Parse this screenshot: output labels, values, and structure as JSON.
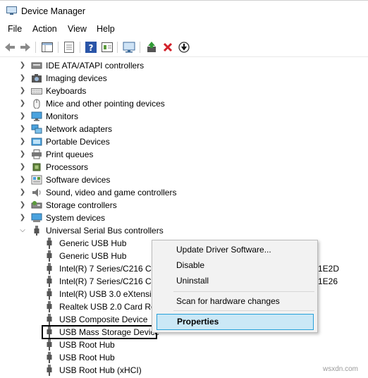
{
  "window": {
    "title": "Device Manager"
  },
  "menu": [
    "File",
    "Action",
    "View",
    "Help"
  ],
  "toolbar": {
    "icons": [
      "back-arrow-icon",
      "forward-arrow-icon",
      "show-hide-tree-icon",
      "properties-icon",
      "help-icon",
      "action-view-icon",
      "scan-monitor-icon",
      "update-driver-icon",
      "uninstall-x-icon",
      "disable-down-arrow-icon"
    ]
  },
  "tree": {
    "categories": [
      {
        "label": "IDE ATA/ATAPI controllers",
        "icon": "ide-controller-icon"
      },
      {
        "label": "Imaging devices",
        "icon": "camera-icon"
      },
      {
        "label": "Keyboards",
        "icon": "keyboard-icon"
      },
      {
        "label": "Mice and other pointing devices",
        "icon": "mouse-icon"
      },
      {
        "label": "Monitors",
        "icon": "monitor-icon"
      },
      {
        "label": "Network adapters",
        "icon": "network-adapter-icon"
      },
      {
        "label": "Portable Devices",
        "icon": "portable-device-icon"
      },
      {
        "label": "Print queues",
        "icon": "printer-icon"
      },
      {
        "label": "Processors",
        "icon": "processor-icon"
      },
      {
        "label": "Software devices",
        "icon": "software-device-icon"
      },
      {
        "label": "Sound, video and game controllers",
        "icon": "speaker-icon"
      },
      {
        "label": "Storage controllers",
        "icon": "storage-controller-icon"
      },
      {
        "label": "System devices",
        "icon": "system-device-icon"
      }
    ],
    "usb_category": {
      "label": "Universal Serial Bus controllers",
      "icon": "usb-plug-icon"
    },
    "usb_devices": [
      {
        "label": "Generic USB Hub",
        "right": ""
      },
      {
        "label": "Generic USB Hub",
        "right": ""
      },
      {
        "label": "Intel(R) 7 Series/C216 Chi",
        "right": "1E2D"
      },
      {
        "label": "Intel(R) 7 Series/C216 Chi",
        "right": "1E26"
      },
      {
        "label": "Intel(R) USB 3.0 eXtensibl",
        "right": ""
      },
      {
        "label": "Realtek USB 2.0 Card Rea",
        "right": ""
      },
      {
        "label": "USB Composite Device",
        "right": ""
      },
      {
        "label": "USB Mass Storage Device",
        "right": ""
      },
      {
        "label": "USB Root Hub",
        "right": ""
      },
      {
        "label": "USB Root Hub",
        "right": ""
      },
      {
        "label": "USB Root Hub (xHCI)",
        "right": ""
      }
    ]
  },
  "context_menu": {
    "items": [
      "Update Driver Software...",
      "Disable",
      "Uninstall",
      "Scan for hardware changes"
    ],
    "selected": "Properties"
  },
  "watermark": "wsxdn.com",
  "colors": {
    "highlight_bg": "#cbe8f6",
    "highlight_border": "#26a0da",
    "menu_bg": "#f2f2f2"
  }
}
